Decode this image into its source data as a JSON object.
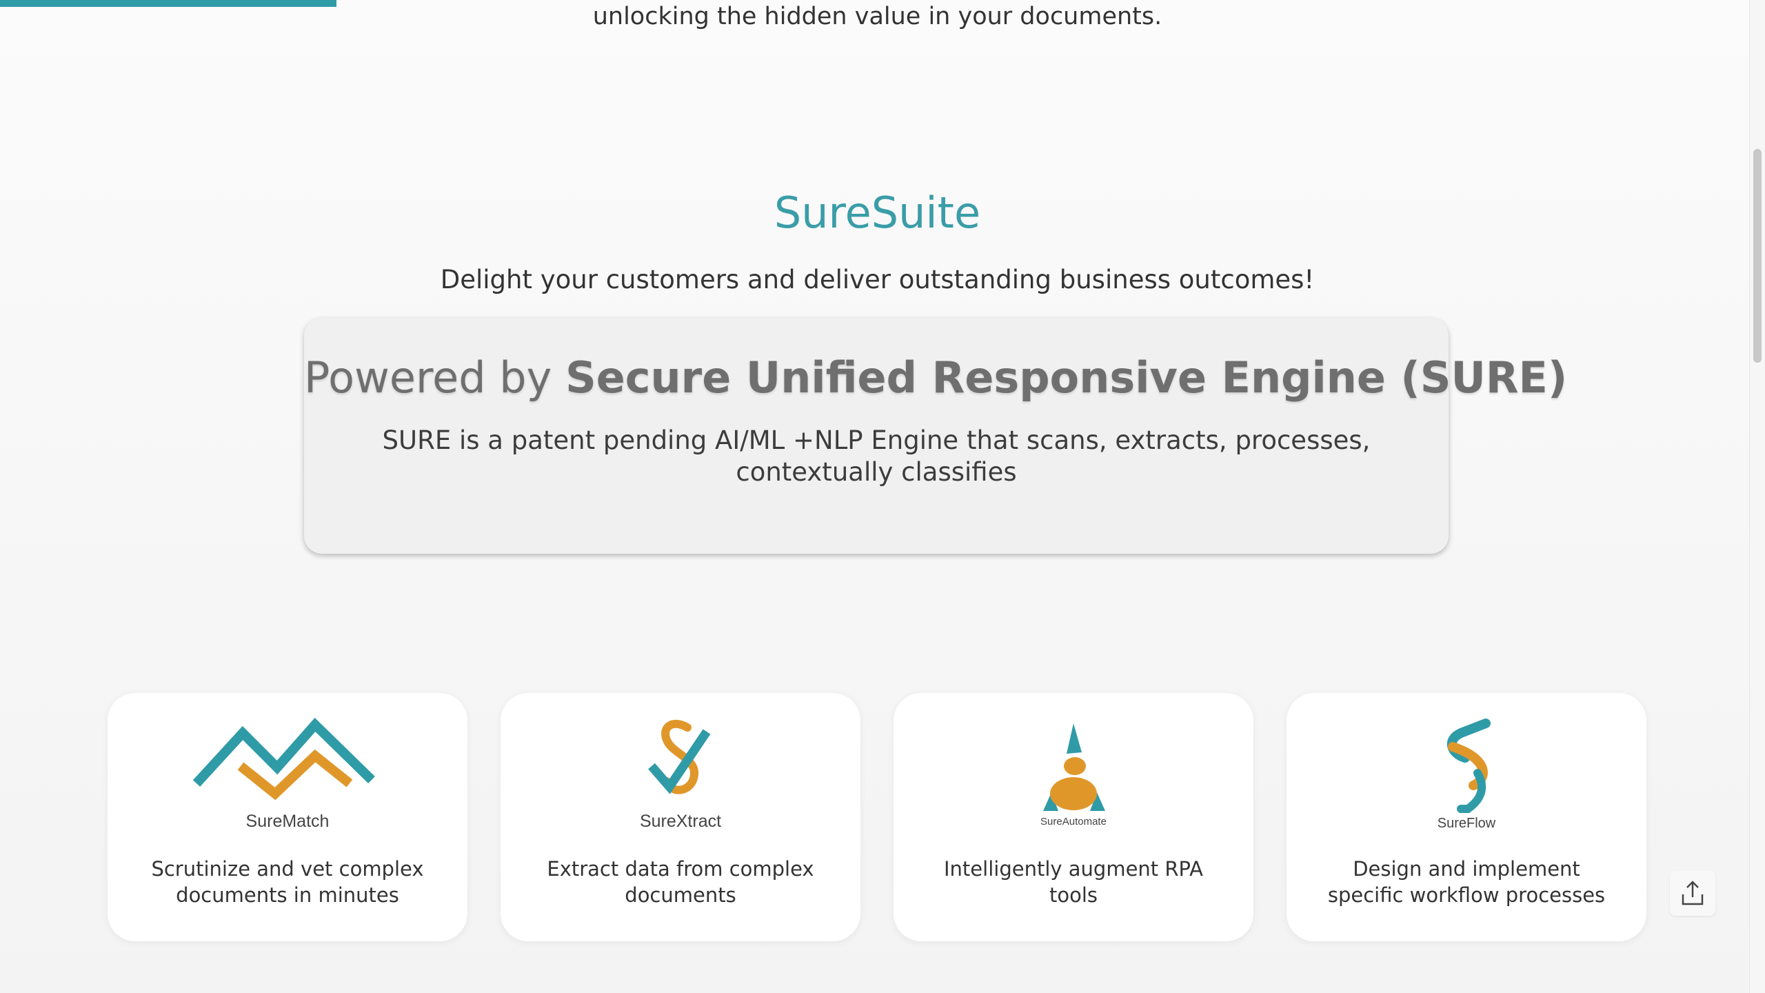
{
  "intro": {
    "text": "unlocking the hidden value in your documents."
  },
  "suite": {
    "title": "SureSuite",
    "subtitle": "Delight your customers and deliver outstanding business outcomes!"
  },
  "engine": {
    "heading_prefix": "Powered by ",
    "heading_bold": "Secure Unified Responsive Engine (SURE)",
    "description": "SURE is a patent pending AI/ML +NLP Engine that scans, extracts, processes, contextually classifies"
  },
  "products": [
    {
      "name": "SureMatch",
      "description": "Scrutinize and vet complex documents in minutes",
      "logo_icon": "surematch-logo-icon"
    },
    {
      "name": "SureXtract",
      "description": "Extract data from complex documents",
      "logo_icon": "surextract-logo-icon"
    },
    {
      "name": "SureAutomate",
      "description": "Intelligently augment RPA tools",
      "logo_icon": "sureautomate-logo-icon"
    },
    {
      "name": "SureFlow",
      "description": "Design and implement specific workflow processes",
      "logo_icon": "sureflow-logo-icon"
    }
  ],
  "share": {
    "icon": "share-upload-icon"
  },
  "colors": {
    "teal": "#2f9ba7",
    "orange": "#e0972a",
    "title_teal": "#3a9da8"
  }
}
